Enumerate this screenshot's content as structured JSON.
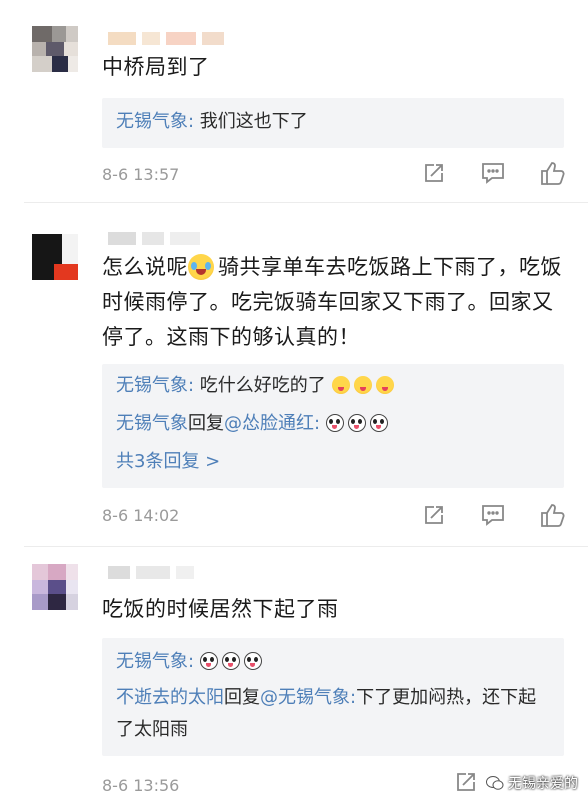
{
  "comments": [
    {
      "text": "中桥局到了",
      "replies": [
        {
          "name": "无锡气象:",
          "text": " 我们这也下了"
        }
      ],
      "time": "8-6 13:57"
    },
    {
      "text": "怎么说呢",
      "text_after": "骑共享单车去吃饭路上下雨了，吃饭时候雨停了。吃完饭骑车回家又下雨了。回家又停了。这雨下的够认真的！",
      "replies": [
        {
          "name": "无锡气象:",
          "text": " 吃什么好吃的了"
        },
        {
          "name": "无锡气象",
          "text": "回复",
          "mention": "@怂脸通红:"
        }
      ],
      "more": "共3条回复 >",
      "time": "8-6 14:02"
    },
    {
      "text": "吃饭的时候居然下起了雨",
      "replies": [
        {
          "name": "无锡气象:",
          "text": ""
        },
        {
          "name": "不逝去的太阳",
          "text": "回复",
          "mention": "@无锡气象:",
          "text2": "下了更加闷热，还下起了太阳雨"
        }
      ],
      "time": "8-6 13:56"
    }
  ],
  "icons": {
    "share": "share-icon",
    "comment": "comment-icon",
    "like": "thumbs-up-icon"
  },
  "watermark": {
    "text": "无锡亲爱的"
  },
  "colors": {
    "link": "#4e7fb8",
    "meta": "#9a9a9a",
    "reply_bg": "#f3f4f6"
  }
}
